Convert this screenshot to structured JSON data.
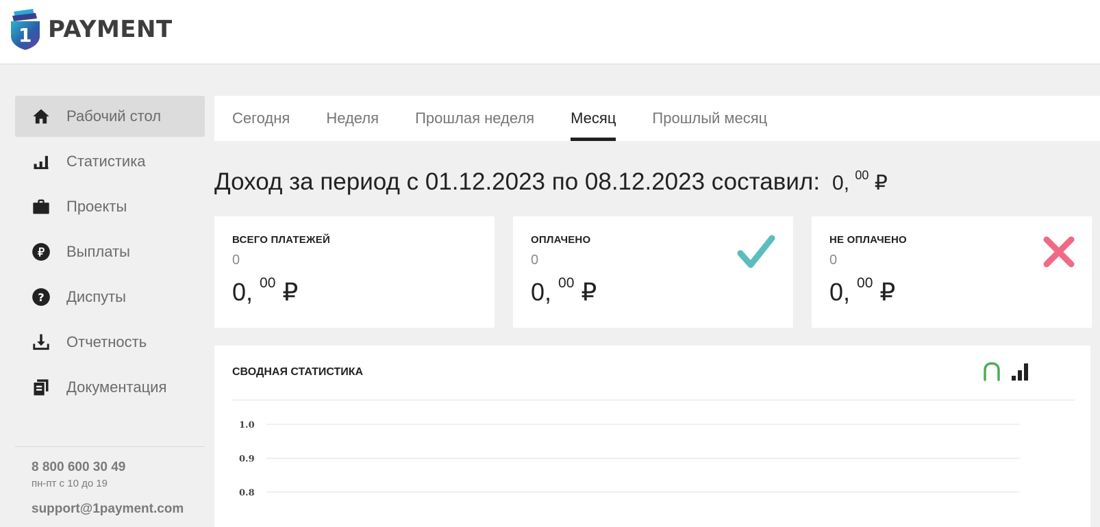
{
  "brand": {
    "name": "PAYMENT",
    "mark_digit": "1"
  },
  "sidebar": {
    "items": [
      {
        "label": "Рабочий стол",
        "icon": "home-icon",
        "active": true
      },
      {
        "label": "Статистика",
        "icon": "stats-icon"
      },
      {
        "label": "Проекты",
        "icon": "briefcase-icon"
      },
      {
        "label": "Выплаты",
        "icon": "ruble-icon"
      },
      {
        "label": "Диспуты",
        "icon": "question-icon"
      },
      {
        "label": "Отчетность",
        "icon": "download-icon"
      },
      {
        "label": "Документация",
        "icon": "documents-icon"
      }
    ],
    "phone": "8 800 600 30 49",
    "hours": "пн-пт с 10 до 19",
    "email": "support@1payment.com"
  },
  "tabs": [
    {
      "label": "Сегодня"
    },
    {
      "label": "Неделя"
    },
    {
      "label": "Прошлая неделя"
    },
    {
      "label": "Месяц",
      "active": true
    },
    {
      "label": "Прошлый месяц"
    }
  ],
  "income": {
    "text": "Доход за период с 01.12.2023 по 08.12.2023 составил:",
    "whole": "0,",
    "cents": "00",
    "currency": "₽"
  },
  "cards": [
    {
      "title": "ВСЕГО ПЛАТЕЖЕЙ",
      "count": "0",
      "whole": "0,",
      "cents": "00",
      "currency": "₽"
    },
    {
      "title": "ОПЛАЧЕНО",
      "count": "0",
      "whole": "0,",
      "cents": "00",
      "currency": "₽",
      "icon": "check-icon",
      "color": "#5bbdbd"
    },
    {
      "title": "НЕ ОПЛАЧЕНО",
      "count": "0",
      "whole": "0,",
      "cents": "00",
      "currency": "₽",
      "icon": "cross-icon",
      "color": "#f06a85"
    }
  ],
  "summary": {
    "title": "СВОДНАЯ СТАТИСТИКА",
    "icons": [
      "line-chart-toggle-icon",
      "bar-chart-toggle-icon"
    ],
    "line_icon_color": "#4caf50"
  },
  "chart_data": {
    "type": "line",
    "title": "",
    "ylabel": "",
    "xlabel": "",
    "y_ticks": [
      "1.0",
      "0.9",
      "0.8"
    ],
    "ylim": [
      0.8,
      1.0
    ],
    "grid": true,
    "series": []
  }
}
